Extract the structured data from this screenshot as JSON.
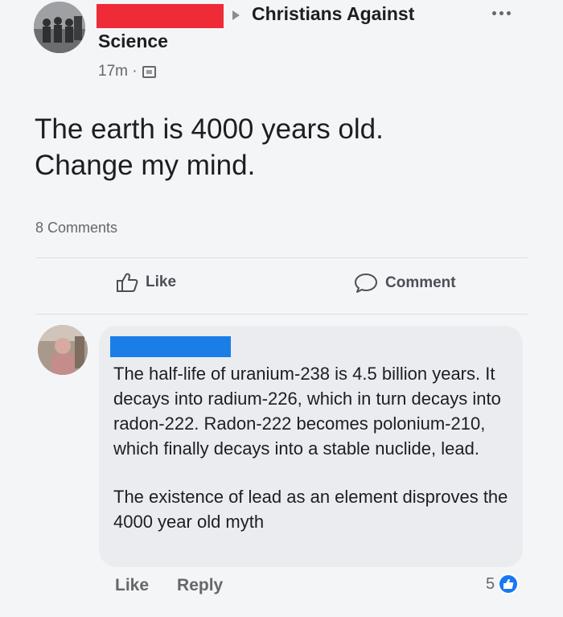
{
  "post": {
    "group_name_line1": "Christians Against",
    "group_name_line2": "Science",
    "time": "17m ·",
    "text_line1": "The earth is 4000 years old.",
    "text_line2": "Change my mind.",
    "comments_count": "8 Comments"
  },
  "actions": {
    "like": "Like",
    "comment": "Comment"
  },
  "comment": {
    "paragraph1": "The half-life of uranium-238 is 4.5 billion years. It decays into radium-226, which in turn decays into radon-222. Radon-222 becomes polonium-210, which finally decays into a stable nuclide, lead.",
    "paragraph2": "The existence of lead as an element disproves the 4000 year old myth",
    "like": "Like",
    "reply": "Reply",
    "reaction_count": "5"
  },
  "icons": {
    "share_arrow": "arrow-right-icon",
    "more": "more-options-icon",
    "privacy": "globe-icon",
    "like": "thumbs-up-icon",
    "comment": "speech-bubble-icon",
    "reaction": "like-reaction-icon"
  },
  "colors": {
    "author_redaction": "#ef2b37",
    "commenter_redaction": "#1a7ee6",
    "reaction_blue": "#1877f2"
  }
}
